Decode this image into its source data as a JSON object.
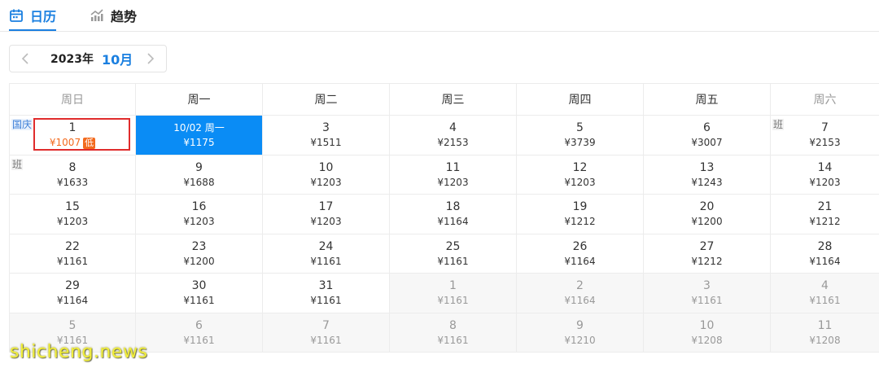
{
  "tabs": [
    {
      "label": "日历",
      "icon": "calendar-icon",
      "active": true
    },
    {
      "label": "趋势",
      "icon": "trend-chart-icon",
      "active": false
    }
  ],
  "month_nav": {
    "year": "2023年",
    "month": "10月",
    "prev_icon": "chevron-left-icon",
    "next_icon": "chevron-right-icon"
  },
  "weekdays": [
    "周日",
    "周一",
    "周二",
    "周三",
    "周四",
    "周五",
    "周六"
  ],
  "colors": {
    "accent": "#1a7fe0",
    "selected_bg": "#0a8cf5",
    "lowest": "#f36a1d",
    "highlight_border": "#e02c2c",
    "other_month_bg": "#f7f7f7"
  },
  "weeks": [
    [
      {
        "day": "1",
        "price": "¥1007",
        "lowest": true,
        "badge": "低",
        "tag": "国庆",
        "tag_type": "holiday",
        "highlighted": true
      },
      {
        "day": "10/02 周一",
        "price": "¥1175",
        "selected": true
      },
      {
        "day": "3",
        "price": "¥1511"
      },
      {
        "day": "4",
        "price": "¥2153"
      },
      {
        "day": "5",
        "price": "¥3739"
      },
      {
        "day": "6",
        "price": "¥3007"
      },
      {
        "day": "7",
        "price": "¥2153",
        "tag": "班",
        "tag_type": "work"
      }
    ],
    [
      {
        "day": "8",
        "price": "¥1633",
        "tag": "班",
        "tag_type": "work"
      },
      {
        "day": "9",
        "price": "¥1688"
      },
      {
        "day": "10",
        "price": "¥1203"
      },
      {
        "day": "11",
        "price": "¥1203"
      },
      {
        "day": "12",
        "price": "¥1203"
      },
      {
        "day": "13",
        "price": "¥1243"
      },
      {
        "day": "14",
        "price": "¥1203"
      }
    ],
    [
      {
        "day": "15",
        "price": "¥1203"
      },
      {
        "day": "16",
        "price": "¥1203"
      },
      {
        "day": "17",
        "price": "¥1203"
      },
      {
        "day": "18",
        "price": "¥1164"
      },
      {
        "day": "19",
        "price": "¥1212"
      },
      {
        "day": "20",
        "price": "¥1200"
      },
      {
        "day": "21",
        "price": "¥1212"
      }
    ],
    [
      {
        "day": "22",
        "price": "¥1161"
      },
      {
        "day": "23",
        "price": "¥1200"
      },
      {
        "day": "24",
        "price": "¥1161"
      },
      {
        "day": "25",
        "price": "¥1161"
      },
      {
        "day": "26",
        "price": "¥1164"
      },
      {
        "day": "27",
        "price": "¥1212"
      },
      {
        "day": "28",
        "price": "¥1164"
      }
    ],
    [
      {
        "day": "29",
        "price": "¥1164"
      },
      {
        "day": "30",
        "price": "¥1161"
      },
      {
        "day": "31",
        "price": "¥1161"
      },
      {
        "day": "1",
        "price": "¥1161",
        "other": true
      },
      {
        "day": "2",
        "price": "¥1164",
        "other": true
      },
      {
        "day": "3",
        "price": "¥1161",
        "other": true
      },
      {
        "day": "4",
        "price": "¥1161",
        "other": true
      }
    ],
    [
      {
        "day": "5",
        "price": "¥1161",
        "other": true
      },
      {
        "day": "6",
        "price": "¥1161",
        "other": true
      },
      {
        "day": "7",
        "price": "¥1161",
        "other": true
      },
      {
        "day": "8",
        "price": "¥1161",
        "other": true
      },
      {
        "day": "9",
        "price": "¥1210",
        "other": true
      },
      {
        "day": "10",
        "price": "¥1208",
        "other": true
      },
      {
        "day": "11",
        "price": "¥1208",
        "other": true
      }
    ]
  ],
  "watermark": "shicheng.news"
}
